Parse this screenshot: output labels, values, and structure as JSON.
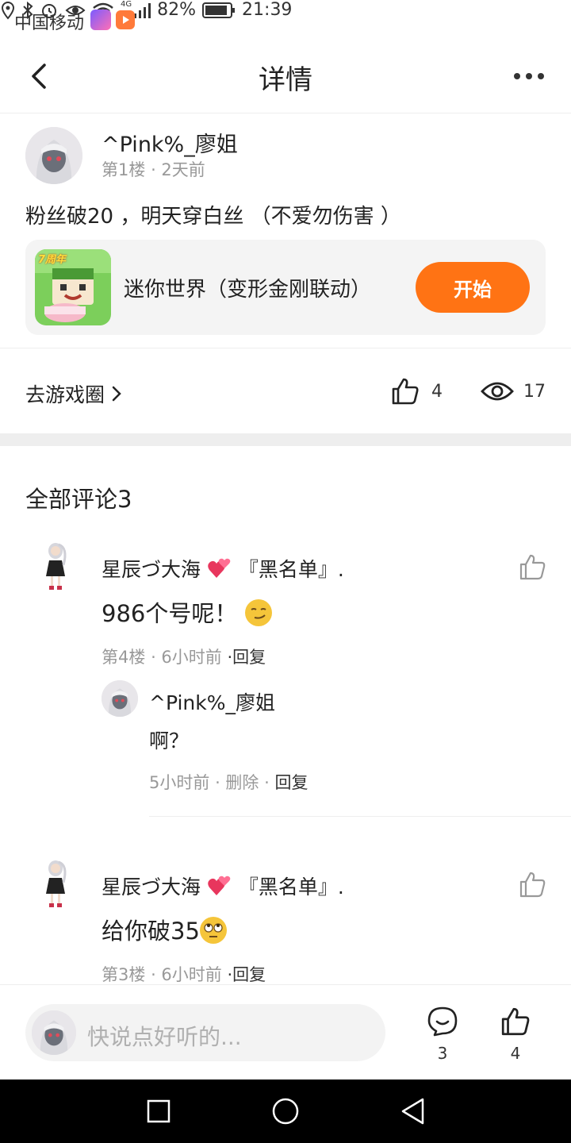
{
  "status_bar": {
    "carrier": "中国移动",
    "network": "4G",
    "battery": "82%",
    "time": "21:39"
  },
  "header": {
    "title": "详情"
  },
  "post": {
    "author": "^Pink%_廖姐",
    "floor": "第1楼",
    "time": "2天前",
    "content": "粉丝破20 ，明天穿白丝 （不爱勿伤害 ）",
    "game": {
      "name": "迷你世界（变形金刚联动）",
      "button": "开始",
      "badge": "7周年"
    },
    "goto_label": "去游戏圈",
    "likes": "4",
    "views": "17"
  },
  "comments": {
    "title": "全部评论3",
    "items": [
      {
        "name": "星辰づ大海",
        "tag": "『黑名单』.",
        "text": "986个号呢！",
        "floor": "第4楼",
        "time": "6小时前",
        "reply_label": "·回复",
        "replies": [
          {
            "name": "^Pink%_廖姐",
            "text": "啊？",
            "time": "5小时前",
            "delete_label": "删除",
            "reply_label": "回复"
          }
        ]
      },
      {
        "name": "星辰づ大海",
        "tag": "『黑名单』.",
        "text": "给你破35",
        "floor": "第3楼",
        "time": "6小时前",
        "reply_label": "·回复"
      }
    ]
  },
  "bottom_bar": {
    "placeholder": "快说点好听的...",
    "comment_count": "3",
    "like_count": "4"
  },
  "colors": {
    "accent": "#ff7314",
    "muted": "#999999"
  }
}
